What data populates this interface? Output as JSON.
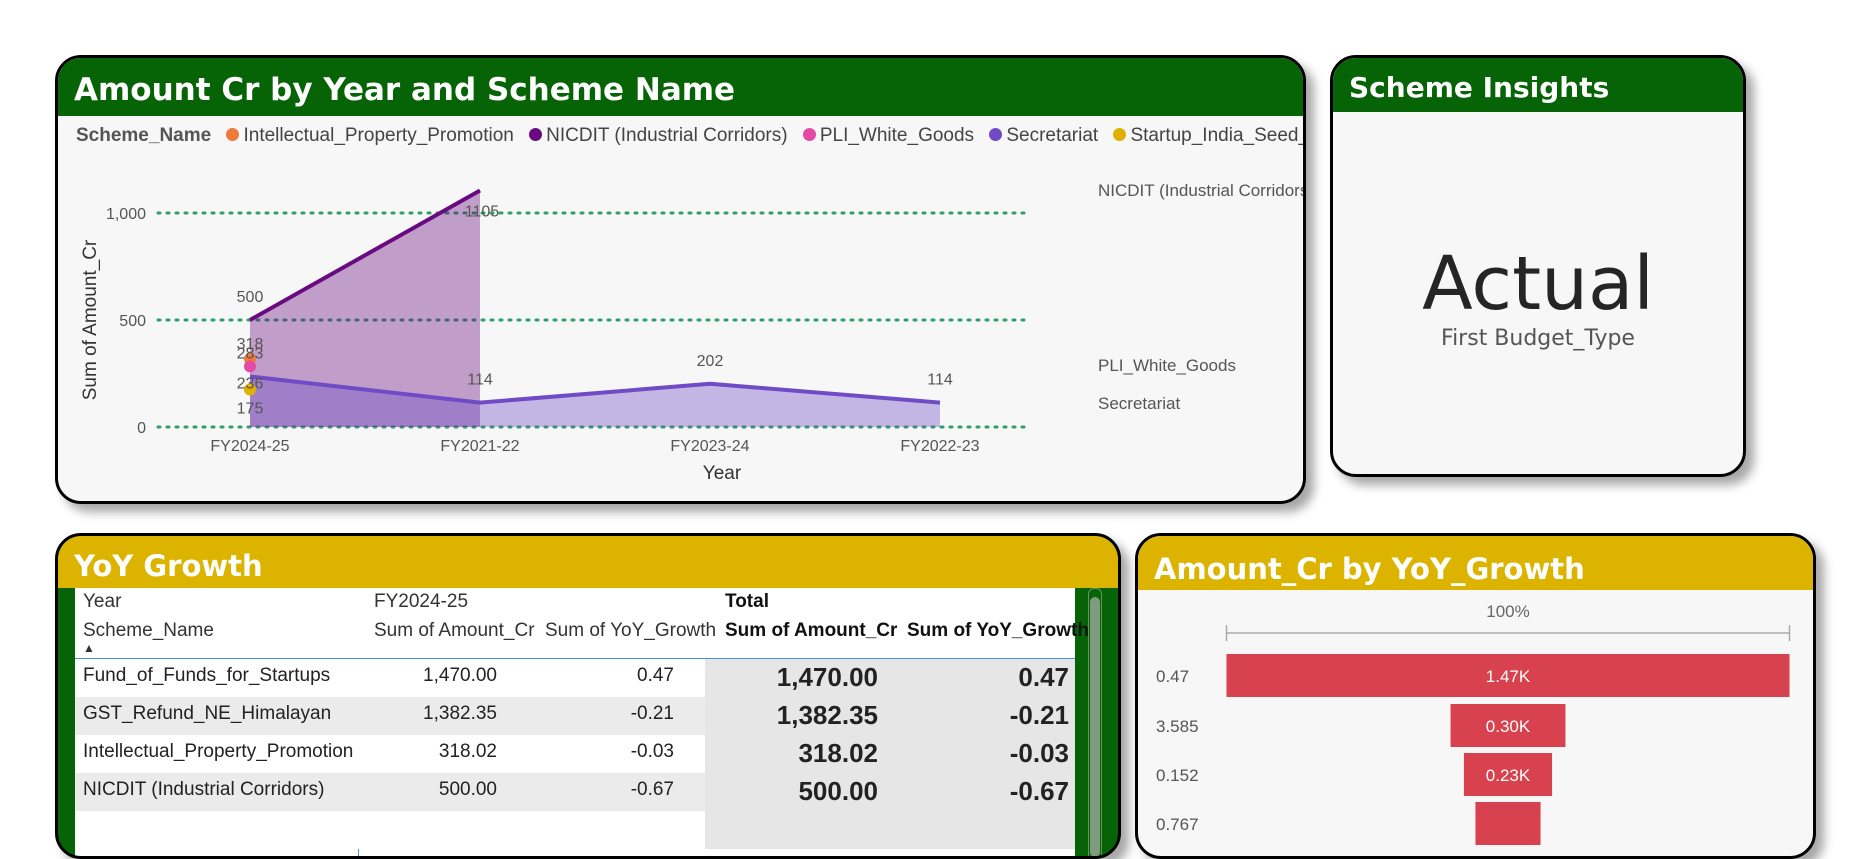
{
  "colors": {
    "header_green": "#066406",
    "header_gold": "#dcb400",
    "gridline": "#2e9e6a",
    "intellectual_property": "#f07a3a",
    "nicdit": "#6a0a80",
    "pli_white_goods": "#e34aa6",
    "secretariat": "#6f4cc5",
    "startup_seed": "#e0b000",
    "funnel_bar": "#d7424e"
  },
  "chart_card": {
    "title": "Amount Cr by Year and Scheme Name",
    "legend_title": "Scheme_Name",
    "legend": [
      {
        "name": "Intellectual_Property_Promotion",
        "color": "#f07a3a"
      },
      {
        "name": "NICDIT (Industrial Corridors)",
        "color": "#6a0a80"
      },
      {
        "name": "PLI_White_Goods",
        "color": "#e34aa6"
      },
      {
        "name": "Secretariat",
        "color": "#6f4cc5"
      },
      {
        "name": "Startup_India_Seed_Fund",
        "color": "#e0b000"
      }
    ],
    "chart_data": {
      "type": "area",
      "title": "Amount Cr by Year and Scheme Name",
      "xlabel": "Year",
      "ylabel": "Sum of Amount_Cr",
      "categories": [
        "FY2024-25",
        "FY2021-22",
        "FY2023-24",
        "FY2022-23"
      ],
      "ylim": [
        0,
        1150
      ],
      "yticks": [
        0,
        500,
        1000
      ],
      "ytick_labels": [
        "0",
        "500",
        "1,000"
      ],
      "grid": true,
      "legend_position": "top-left",
      "series": [
        {
          "name": "NICDIT (Industrial Corridors)",
          "values": [
            500,
            1105,
            null,
            null
          ],
          "labels": [
            "500",
            "1105",
            "",
            ""
          ],
          "color": "#6a0a80",
          "end_label": "NICDIT (Industrial Corridors)"
        },
        {
          "name": "Secretariat",
          "values": [
            236,
            114,
            202,
            114
          ],
          "labels": [
            "236",
            "114",
            "202",
            "114"
          ],
          "color": "#6f4cc5",
          "end_label": "Secretariat"
        },
        {
          "name": "Intellectual_Property_Promotion",
          "values": [
            318,
            null,
            null,
            null
          ],
          "labels": [
            "318",
            "",
            "",
            ""
          ],
          "color": "#f07a3a"
        },
        {
          "name": "PLI_White_Goods",
          "values": [
            283,
            null,
            null,
            null
          ],
          "labels": [
            "283",
            "",
            "",
            ""
          ],
          "color": "#e34aa6",
          "end_label": "PLI_White_Goods"
        },
        {
          "name": "Startup_India_Seed_Fund",
          "values": [
            175,
            null,
            null,
            null
          ],
          "labels": [
            "175",
            "",
            "",
            ""
          ],
          "color": "#e0b000"
        }
      ]
    }
  },
  "insights_card": {
    "title": "Scheme Insights",
    "value": "Actual",
    "label": "First Budget_Type"
  },
  "yoy_card": {
    "title": "YoY Growth",
    "header_row1": {
      "year_label": "Year",
      "year_value": "FY2024-25",
      "total_label": "Total"
    },
    "header_row2": {
      "scheme": "Scheme_Name",
      "amount": "Sum of Amount_Cr",
      "growth": "Sum of YoY_Growth",
      "total_amount": "Sum of Amount_Cr",
      "total_growth": "Sum of YoY_Growth"
    },
    "sort_indicator": "▲",
    "rows": [
      {
        "scheme": "Fund_of_Funds_for_Startups",
        "amount": "1,470.00",
        "growth": "0.47",
        "total_amount": "1,470.00",
        "total_growth": "0.47"
      },
      {
        "scheme": "GST_Refund_NE_Himalayan",
        "amount": "1,382.35",
        "growth": "-0.21",
        "total_amount": "1,382.35",
        "total_growth": "-0.21"
      },
      {
        "scheme": "Intellectual_Property_Promotion",
        "amount": "318.02",
        "growth": "-0.03",
        "total_amount": "318.02",
        "total_growth": "-0.03"
      },
      {
        "scheme": "NICDIT (Industrial Corridors)",
        "amount": "500.00",
        "growth": "-0.67",
        "total_amount": "500.00",
        "total_growth": "-0.67"
      }
    ]
  },
  "funnel_card": {
    "title": "Amount_Cr by YoY_Growth",
    "top_label": "100%",
    "chart_data": {
      "type": "bar",
      "categories": [
        "0.47",
        "3.585",
        "0.152",
        "0.767"
      ],
      "values": [
        1470,
        300,
        230,
        170
      ],
      "value_labels": [
        "1.47K",
        "0.30K",
        "0.23K",
        ""
      ]
    }
  }
}
